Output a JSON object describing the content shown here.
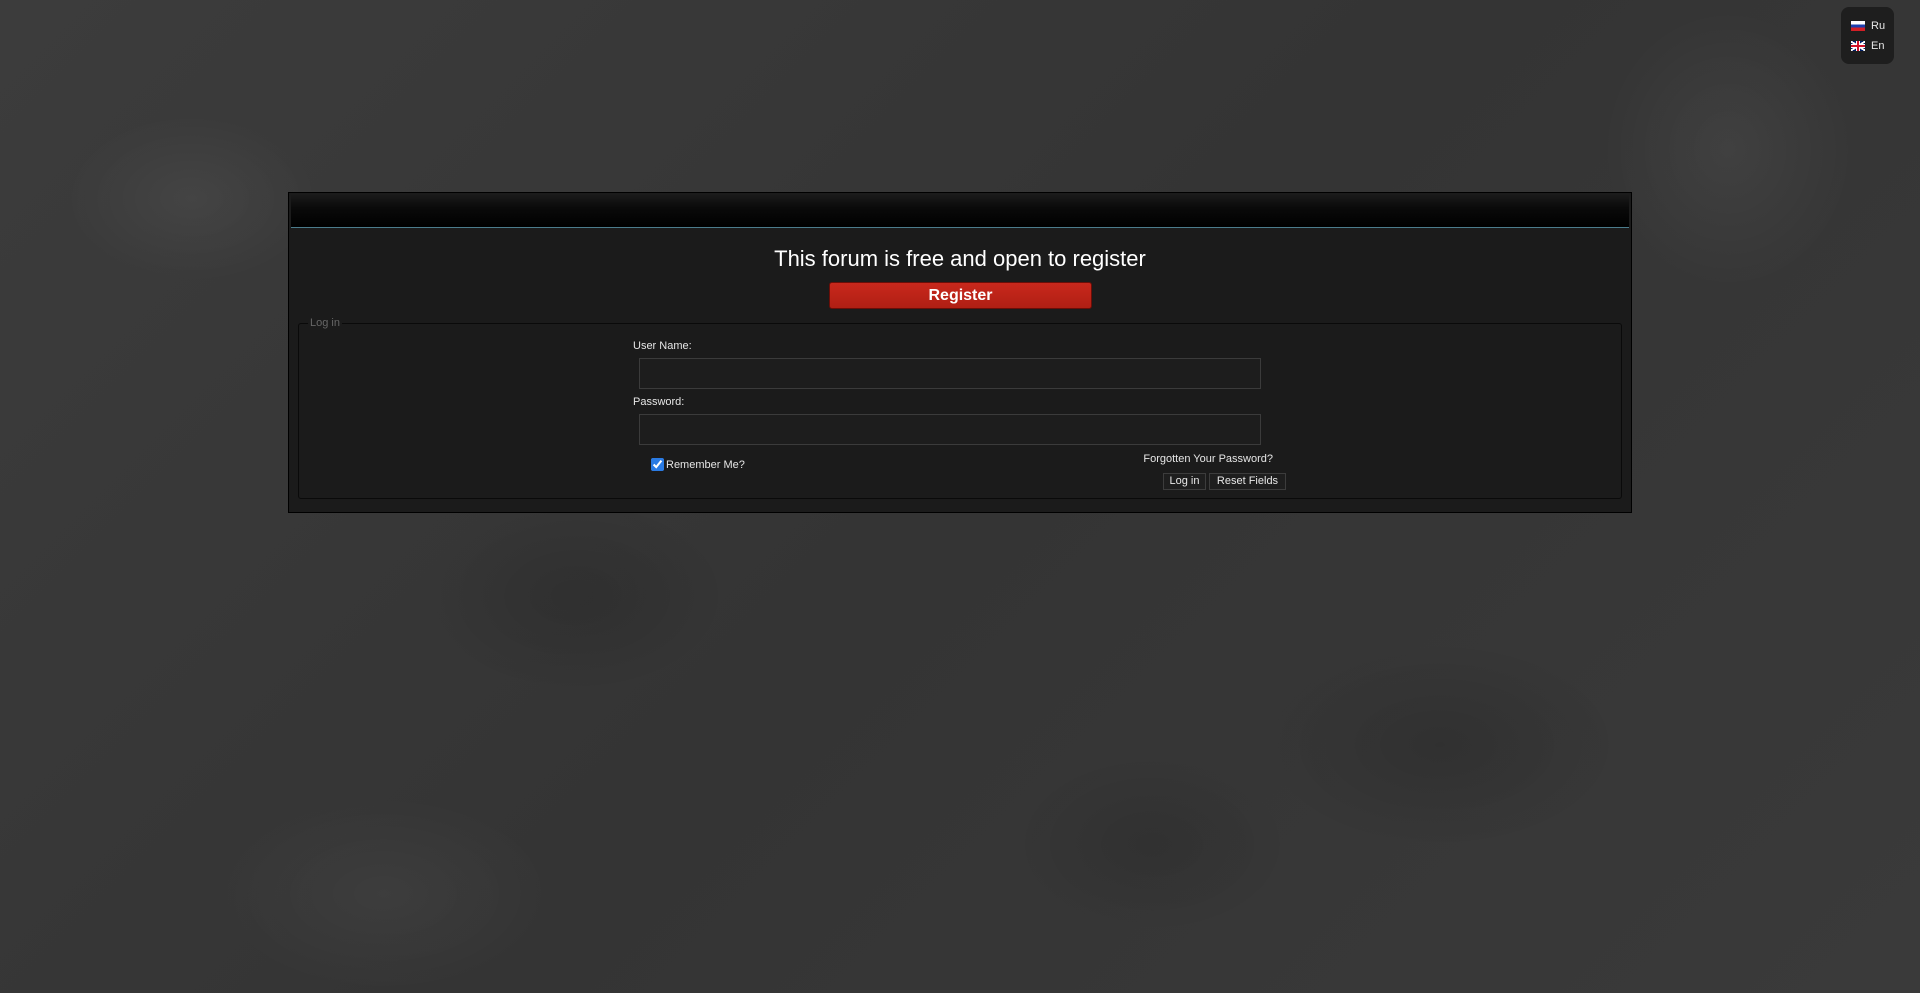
{
  "language_switcher": {
    "items": [
      {
        "label": "Ru",
        "flag": "russia-flag-icon"
      },
      {
        "label": "En",
        "flag": "uk-flag-icon"
      }
    ]
  },
  "main": {
    "headline": "This forum is free and open to register",
    "register_label": "Register"
  },
  "login": {
    "legend": "Log in",
    "username_label": "User Name:",
    "username_value": "",
    "password_label": "Password:",
    "password_value": "",
    "remember_label": "Remember Me?",
    "remember_checked": true,
    "forgot_label": "Forgotten Your Password?",
    "login_button": "Log in",
    "reset_button": "Reset Fields"
  },
  "colors": {
    "register_red": "#c8281c",
    "header_accent": "#4b7c8c",
    "panel_bg": "#1b1b1b"
  }
}
